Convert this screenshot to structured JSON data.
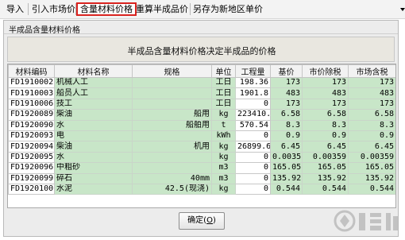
{
  "menubar": {
    "items": [
      "导入",
      "引入市场价",
      "含量材料价格",
      "重算半成品价",
      "另存为新地区单价"
    ]
  },
  "dialog": {
    "title": "半成品含量材料价格",
    "header_text": "半成品含量材料价格决定半成品的价格",
    "columns": [
      "材料编码",
      "材料名称",
      "规格",
      "单位",
      "工程量",
      "基价",
      "市价除税",
      "市场含税"
    ],
    "rows": [
      [
        "FD1910002",
        "机械人工",
        "",
        "工日",
        "198.36",
        "173",
        "173",
        "173"
      ],
      [
        "FD1910003",
        "船员人工",
        "",
        "工日",
        "1901.8",
        "483",
        "483",
        "483"
      ],
      [
        "FD1910006",
        "技工",
        "",
        "工日",
        "0",
        "173",
        "173",
        "173"
      ],
      [
        "FD1920089",
        "柴油",
        "船用",
        "kg",
        "223410.",
        "6.58",
        "6.58",
        "6.58"
      ],
      [
        "FD1920090",
        "水",
        "船舶用",
        "t",
        "570.54",
        "8.3",
        "8.3",
        "8.3"
      ],
      [
        "FD1920093",
        "电",
        "",
        "kWh",
        "0",
        "0.9",
        "0.9",
        "0.9"
      ],
      [
        "FD1920094",
        "柴油",
        "机用",
        "kg",
        "26899.6",
        "6.45",
        "6.45",
        "6.45"
      ],
      [
        "FD1920095",
        "水",
        "",
        "kg",
        "0",
        "0.0035",
        "0.00359",
        "0.00359"
      ],
      [
        "FD1920096",
        "中粗砂",
        "",
        "m3",
        "0",
        "165.05",
        "165.05",
        "165.05"
      ],
      [
        "FD1920099",
        "碎石",
        "40mm",
        "m3",
        "0",
        "135.92",
        "135.92",
        "135.92"
      ],
      [
        "FD1920100",
        "水泥",
        "42.5(现浇)",
        "kg",
        "0",
        "0.544",
        "0.544",
        "0.544"
      ]
    ],
    "ok_label": "确定",
    "ok_shortcut": "O"
  }
}
